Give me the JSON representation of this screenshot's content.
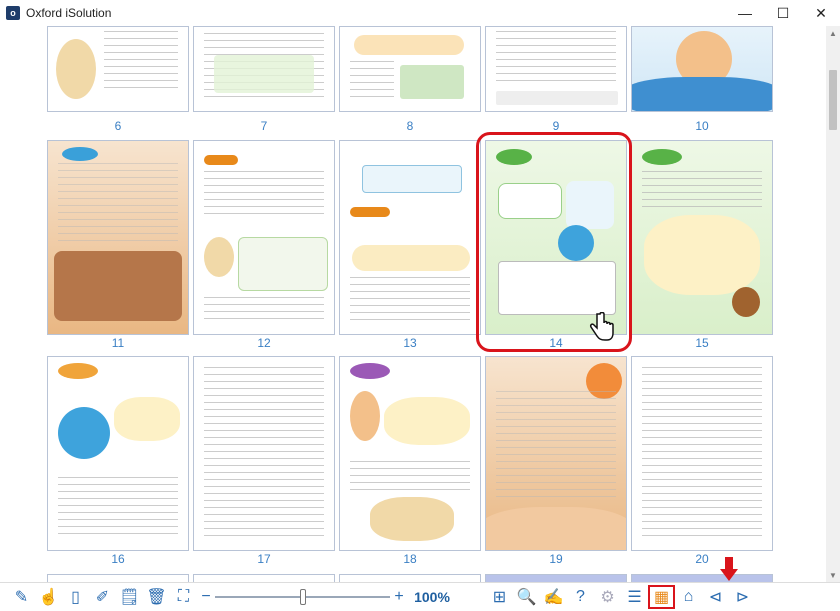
{
  "window": {
    "title": "Oxford iSolution",
    "icon_letter": "o",
    "minimize": "—",
    "maximize": "☐",
    "close": "✕"
  },
  "pages": [
    {
      "num": "6"
    },
    {
      "num": "7"
    },
    {
      "num": "8"
    },
    {
      "num": "9"
    },
    {
      "num": "10"
    },
    {
      "num": "11"
    },
    {
      "num": "12"
    },
    {
      "num": "13"
    },
    {
      "num": "14"
    },
    {
      "num": "15"
    },
    {
      "num": "16"
    },
    {
      "num": "17"
    },
    {
      "num": "18"
    },
    {
      "num": "19"
    },
    {
      "num": "20"
    }
  ],
  "toolbar": {
    "zoom_minus": "−",
    "zoom_plus": "+",
    "zoom_value": "100%",
    "help": "?"
  },
  "colors": {
    "accent": "#2b6cb0",
    "highlight": "#d9141b",
    "page_number": "#3a7fc4"
  }
}
